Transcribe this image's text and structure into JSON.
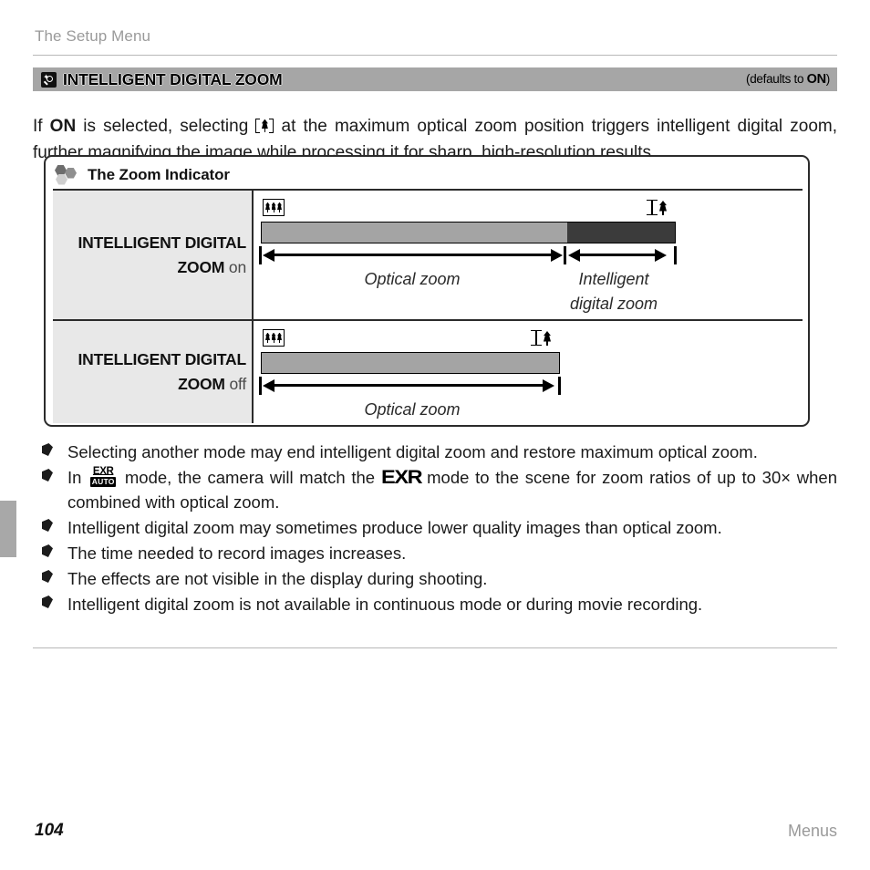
{
  "running_head": "The Setup Menu",
  "section": {
    "icon": "magnifier-sparkle-icon",
    "title": "INTELLIGENT DIGITAL ZOOM",
    "default_prefix": "(defaults to ",
    "default_value": "ON",
    "default_suffix": ")"
  },
  "intro": {
    "part1": "If ",
    "bold1": "ON",
    "part2": " is selected, selecting ",
    "inline_icon": "telephoto-zoom-icon",
    "part3": " at the maximum optical zoom position triggers intelligent digital zoom, further magnifying the image while processing it for sharp, high-resolution results."
  },
  "note": {
    "icon": "hexagons-icon",
    "title": "The Zoom Indicator",
    "rows": [
      {
        "label_bold": "INTELLIGENT DIGITAL ZOOM",
        "label_state": "on",
        "wide_icon": "wide-angle-zoom-icon",
        "tele_icon": "telephoto-zoom-icon",
        "captions": [
          "Optical zoom",
          "Intelligent digital zoom"
        ]
      },
      {
        "label_bold": "INTELLIGENT DIGITAL ZOOM",
        "label_state": "off",
        "wide_icon": "wide-angle-zoom-icon",
        "tele_icon": "telephoto-zoom-icon",
        "captions": [
          "Optical zoom"
        ]
      }
    ]
  },
  "bullets": {
    "b1": "Selecting another mode may end intelligent digital zoom and restore maximum optical zoom.",
    "b2_pre": "In ",
    "b2_icon": "exr-auto-icon",
    "b2_mid": " mode, the camera will match the ",
    "b2_logo": "EXR",
    "b2_post": " mode to the scene for zoom ratios of up to 30× when combined with optical zoom.",
    "b3": "Intelligent digital zoom may sometimes produce lower quality images than optical zoom.",
    "b4": "The time needed to record images increases.",
    "b5": "The effects are not visible in the display during shooting.",
    "b6": "Intelligent digital zoom is not available in continuous mode or during movie recording."
  },
  "footer": {
    "page_number": "104",
    "section_name": "Menus"
  },
  "colors": {
    "section_bar": "#a6a6a6",
    "optical_segment": "#a4a4a4",
    "digital_segment": "#3b3b3b",
    "label_cell": "#e8e8e8",
    "muted_text": "#9a9a9a"
  }
}
